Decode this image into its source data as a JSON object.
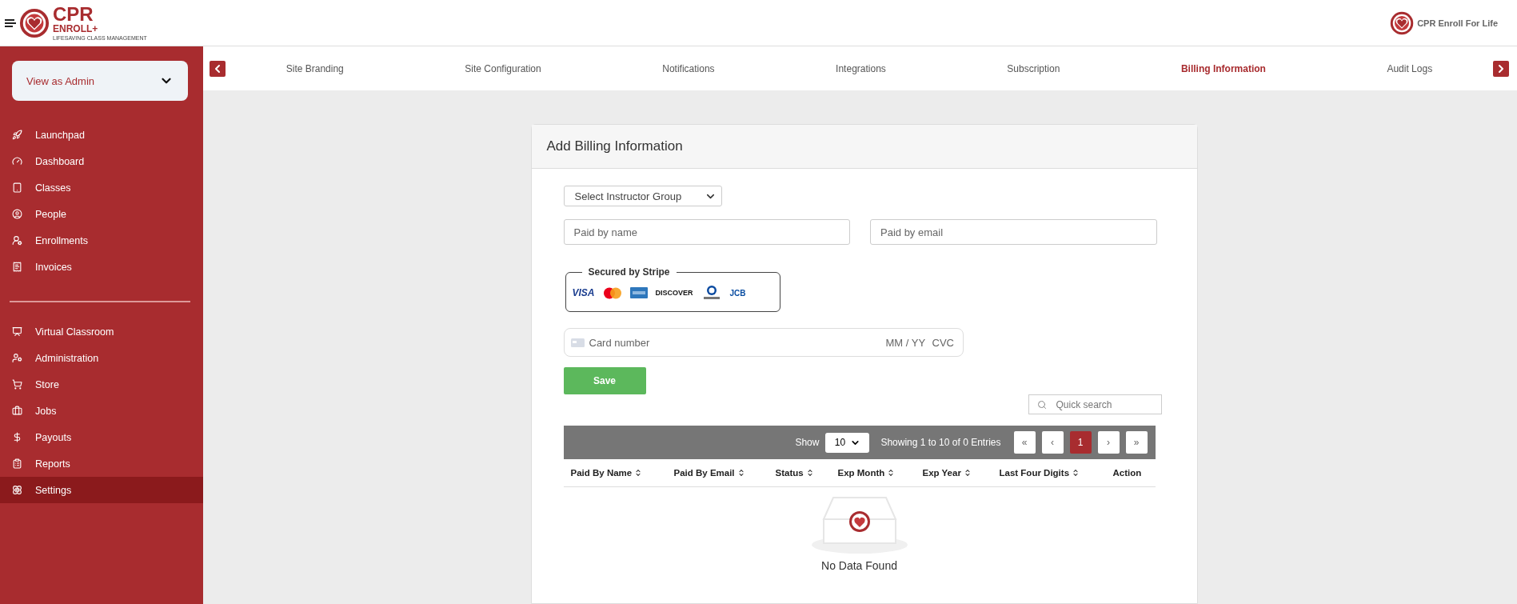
{
  "header": {
    "logo": {
      "title": "CPR",
      "subtitle": "ENROLL+",
      "tagline": "LIFESAVING CLASS MANAGEMENT"
    },
    "org_name": "CPR Enroll For Life"
  },
  "sidebar": {
    "role_select": {
      "value": "View as Admin"
    },
    "groups": [
      [
        {
          "label": "Launchpad",
          "selected": false
        },
        {
          "label": "Dashboard",
          "selected": false
        },
        {
          "label": "Classes",
          "selected": false
        },
        {
          "label": "People",
          "selected": false
        },
        {
          "label": "Enrollments",
          "selected": false
        },
        {
          "label": "Invoices",
          "selected": false
        }
      ],
      [
        {
          "label": "Virtual Classroom",
          "selected": false
        },
        {
          "label": "Administration",
          "selected": false
        },
        {
          "label": "Store",
          "selected": false
        },
        {
          "label": "Jobs",
          "selected": false
        },
        {
          "label": "Payouts",
          "selected": false
        },
        {
          "label": "Reports",
          "selected": false
        },
        {
          "label": "Settings",
          "selected": true
        }
      ]
    ]
  },
  "tabs": [
    {
      "label": "Site Branding",
      "selected": false
    },
    {
      "label": "Site Configuration",
      "selected": false
    },
    {
      "label": "Notifications",
      "selected": false
    },
    {
      "label": "Integrations",
      "selected": false
    },
    {
      "label": "Subscription",
      "selected": false
    },
    {
      "label": "Billing Information",
      "selected": true
    },
    {
      "label": "Audit Logs",
      "selected": false
    }
  ],
  "card": {
    "title": "Add Billing Information",
    "group_select": {
      "value": "Select Instructor Group"
    },
    "name_field": {
      "placeholder": "Paid by name"
    },
    "email_field": {
      "placeholder": "Paid by email"
    },
    "stripe": {
      "legend": "Secured by Stripe",
      "brands": [
        {
          "kind": "visa",
          "label": "VISA"
        },
        {
          "kind": "mastercard"
        },
        {
          "kind": "amex"
        },
        {
          "kind": "discover",
          "label": "DISCOVER"
        },
        {
          "kind": "diners"
        },
        {
          "kind": "jcb",
          "label": "JCB"
        }
      ]
    },
    "card_field": {
      "placeholder": "Card number",
      "expiry_placeholder": "MM / YY",
      "cvc_placeholder": "CVC"
    },
    "save_button": "Save",
    "search": {
      "placeholder": "Quick search"
    },
    "table": {
      "show_label": "Show",
      "page_size": "10",
      "entries_info": "Showing 1 to 10 of 0 Entries",
      "pagination": [
        {
          "label": "«",
          "selected": false
        },
        {
          "label": "‹",
          "selected": false
        },
        {
          "label": "1",
          "selected": true
        },
        {
          "label": "›",
          "selected": false
        },
        {
          "label": "»",
          "selected": false
        }
      ],
      "columns": [
        {
          "label": "Paid By Name",
          "sortable": true
        },
        {
          "label": "Paid By Email",
          "sortable": true
        },
        {
          "label": "Status",
          "sortable": true
        },
        {
          "label": "Exp Month",
          "sortable": true
        },
        {
          "label": "Exp Year",
          "sortable": true
        },
        {
          "label": "Last Four Digits",
          "sortable": true
        },
        {
          "label": "Action",
          "sortable": false
        }
      ],
      "empty_text": "No Data Found"
    }
  }
}
